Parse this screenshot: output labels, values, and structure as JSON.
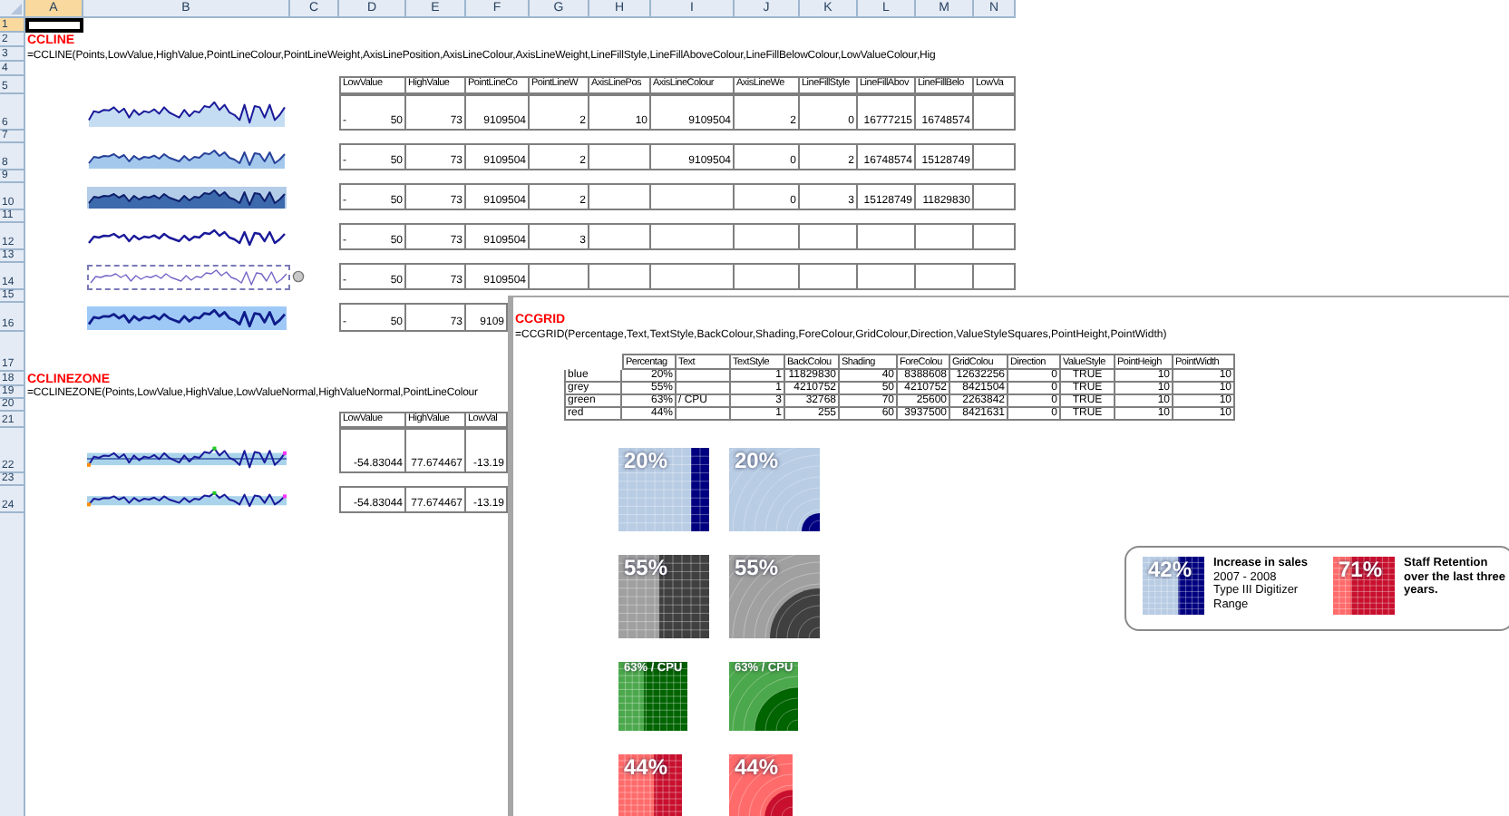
{
  "sheet": {
    "columns": [
      {
        "label": "A",
        "selected": true
      },
      {
        "label": "B",
        "selected": false
      },
      {
        "label": "C",
        "selected": false
      },
      {
        "label": "D",
        "selected": false
      },
      {
        "label": "E",
        "selected": false
      },
      {
        "label": "F",
        "selected": false
      },
      {
        "label": "G",
        "selected": false
      },
      {
        "label": "H",
        "selected": false
      },
      {
        "label": "I",
        "selected": false
      },
      {
        "label": "J",
        "selected": false
      },
      {
        "label": "K",
        "selected": false
      },
      {
        "label": "L",
        "selected": false
      },
      {
        "label": "M",
        "selected": false
      },
      {
        "label": "N",
        "selected": false
      }
    ],
    "rows": [
      {
        "label": "1",
        "selected": true
      },
      {
        "label": "2",
        "selected": false
      },
      {
        "label": "3",
        "selected": false
      },
      {
        "label": "4",
        "selected": false
      },
      {
        "label": "5",
        "selected": false
      },
      {
        "label": "6",
        "selected": false
      },
      {
        "label": "7",
        "selected": false
      },
      {
        "label": "8",
        "selected": false
      },
      {
        "label": "9",
        "selected": false
      },
      {
        "label": "10",
        "selected": false
      },
      {
        "label": "11",
        "selected": false
      },
      {
        "label": "12",
        "selected": false
      },
      {
        "label": "13",
        "selected": false
      },
      {
        "label": "14",
        "selected": false
      },
      {
        "label": "15",
        "selected": false
      },
      {
        "label": "16",
        "selected": false
      },
      {
        "label": "17",
        "selected": false
      },
      {
        "label": "18",
        "selected": false
      },
      {
        "label": "19",
        "selected": false
      },
      {
        "label": "20",
        "selected": false
      },
      {
        "label": "21",
        "selected": false
      },
      {
        "label": "22",
        "selected": false
      },
      {
        "label": "23",
        "selected": false
      },
      {
        "label": "24",
        "selected": false
      }
    ]
  },
  "ccline": {
    "title": "CCLINE",
    "formula": "=CCLINE(Points,LowValue,HighValue,PointLineColour,PointLineWeight,AxisLinePosition,AxisLineColour,AxisLineWeight,LineFillStyle,LineFillAboveColour,LineFillBelowColour,LowValueColour,Hig",
    "table": {
      "columns": [
        "LowValue",
        "HighValue",
        "PointLineCo",
        "PointLineW",
        "AxisLinePos",
        "AxisLineColour",
        "AxisLineWe",
        "LineFillStyle",
        "LineFillAbov",
        "LineFillBelo",
        "LowVa"
      ],
      "rows": [
        {
          "kind": "fill-below",
          "selected": false,
          "sign": "-",
          "cells": [
            "50",
            "73",
            "9109504",
            "2",
            "10",
            "9109504",
            "2",
            "0",
            "16777215",
            "16748574"
          ]
        },
        {
          "kind": "area",
          "selected": false,
          "sign": "-",
          "cells": [
            "50",
            "73",
            "9109504",
            "2",
            null,
            "9109504",
            "0",
            "2",
            "16748574",
            "15128749"
          ]
        },
        {
          "kind": "dark-area",
          "selected": false,
          "sign": "-",
          "cells": [
            "50",
            "73",
            "9109504",
            "2",
            null,
            null,
            "0",
            "3",
            "15128749",
            "11829830"
          ]
        },
        {
          "kind": "line",
          "selected": false,
          "sign": "-",
          "cells": [
            "50",
            "73",
            "9109504",
            "3"
          ]
        },
        {
          "kind": "thin-line",
          "selected": true,
          "sign": "-",
          "cells": [
            "50",
            "73",
            "9109504"
          ]
        },
        {
          "kind": "band",
          "selected": false,
          "sign": "-",
          "cells": [
            "50",
            "73",
            "9109"
          ]
        }
      ]
    }
  },
  "cclinezone": {
    "title": "CCLINEZONE",
    "formula": "=CCLINEZONE(Points,LowValue,HighValue,LowValueNormal,HighValueNormal,PointLineColour",
    "table": {
      "columns": [
        "LowValue",
        "HighValue",
        "LowVal"
      ],
      "rows": [
        {
          "kind": "zone-axis",
          "cells": [
            "-54.83044",
            "77.674467",
            "-13.19"
          ]
        },
        {
          "kind": "zone",
          "cells": [
            "-54.83044",
            "77.674467",
            "-13.19"
          ]
        }
      ]
    }
  },
  "ccgrid": {
    "title": "CCGRID",
    "formula": "=CCGRID(Percentage,Text,TextStyle,BackColour,Shading,ForeColour,GridColour,Direction,ValueStyleSquares,PointHeight,PointWidth)",
    "table": {
      "columns": [
        "Percentag",
        "Text",
        "TextStyle",
        "BackColou",
        "Shading",
        "ForeColou",
        "GridColou",
        "Direction",
        "ValueStyle",
        "PointHeigh",
        "PointWidth"
      ],
      "rows": [
        {
          "name": "blue",
          "cells": [
            "20%",
            null,
            "1",
            "11829830",
            "40",
            "8388608",
            "12632256",
            "0",
            "TRUE",
            "10",
            "10"
          ]
        },
        {
          "name": "grey",
          "cells": [
            "55%",
            null,
            "1",
            "4210752",
            "50",
            "4210752",
            "8421504",
            "0",
            "TRUE",
            "10",
            "10"
          ]
        },
        {
          "name": "green",
          "cells": [
            "63%",
            "/ CPU",
            "3",
            "32768",
            "70",
            "25600",
            "2263842",
            "0",
            "TRUE",
            "10",
            "10"
          ]
        },
        {
          "name": "red",
          "cells": [
            "44%",
            null,
            "1",
            "255",
            "60",
            "3937500",
            "8421631",
            "0",
            "TRUE",
            "10",
            "10"
          ]
        }
      ]
    },
    "tile_rows": [
      {
        "tiles": [
          {
            "kind": "squares",
            "label": "20%",
            "color": "#b8cce4",
            "fill": {
              "level": 0.2,
              "color": "#000080"
            }
          },
          {
            "kind": "circles",
            "label": "20%",
            "color": "#b8cce4",
            "fill": {
              "level": 0.2,
              "color": "#000080"
            }
          }
        ]
      },
      {
        "tiles": [
          {
            "kind": "squares",
            "label": "55%",
            "color": "#a0a0a0",
            "fill": {
              "level": 0.55,
              "color": "#404040"
            }
          },
          {
            "kind": "circles",
            "label": "55%",
            "color": "#a0a0a0",
            "fill": {
              "level": 0.55,
              "color": "#404040"
            }
          }
        ]
      },
      {
        "tiles": [
          {
            "kind": "squares",
            "label": "63% / CPU",
            "color": "#4ca84c",
            "fill": {
              "level": 0.63,
              "color": "#006400"
            }
          },
          {
            "kind": "circles",
            "label": "63% / CPU",
            "color": "#4ca84c",
            "fill": {
              "level": 0.63,
              "color": "#006400"
            }
          }
        ]
      },
      {
        "tiles": [
          {
            "kind": "squares",
            "label": "44%",
            "color": "#ff6b6b",
            "fill": {
              "level": 0.44,
              "color": "#c8102e"
            }
          },
          {
            "kind": "circles",
            "label": "44%",
            "color": "#ff6b6b",
            "fill": {
              "level": 0.44,
              "color": "#c8102e"
            }
          }
        ]
      }
    ],
    "card": [
      {
        "kind": "squares",
        "label": "42%",
        "color": "#b8cce4",
        "fill": {
          "level": 0.42,
          "color": "#000080"
        },
        "heading": "Increase in sales",
        "lines": [
          "2007 - 2008",
          "Type III Digitizer",
          "Range"
        ]
      },
      {
        "kind": "squares",
        "label": "71%",
        "color": "#ff6b6b",
        "fill": {
          "level": 0.71,
          "color": "#c8102e"
        },
        "heading": "Staff Retention over the last three years."
      }
    ]
  }
}
